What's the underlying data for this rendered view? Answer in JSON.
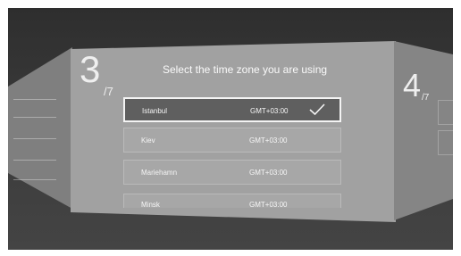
{
  "wizard": {
    "current_step": "3",
    "total_steps": "/7",
    "next_step": "4",
    "next_total": "/7",
    "title": "Select the time zone you are using"
  },
  "timezones": [
    {
      "city": "Istanbul",
      "offset": "GMT+03:00",
      "selected": true
    },
    {
      "city": "Kiev",
      "offset": "GMT+03:00",
      "selected": false
    },
    {
      "city": "Mariehamn",
      "offset": "GMT+03:00",
      "selected": false
    },
    {
      "city": "Minsk",
      "offset": "GMT+03:00",
      "selected": false
    }
  ],
  "icons": {
    "selected_indicator": "check-icon"
  },
  "colors": {
    "panel": "#a1a1a1",
    "selected_row": "#5f5f5f",
    "text": "#f5f5f5"
  }
}
